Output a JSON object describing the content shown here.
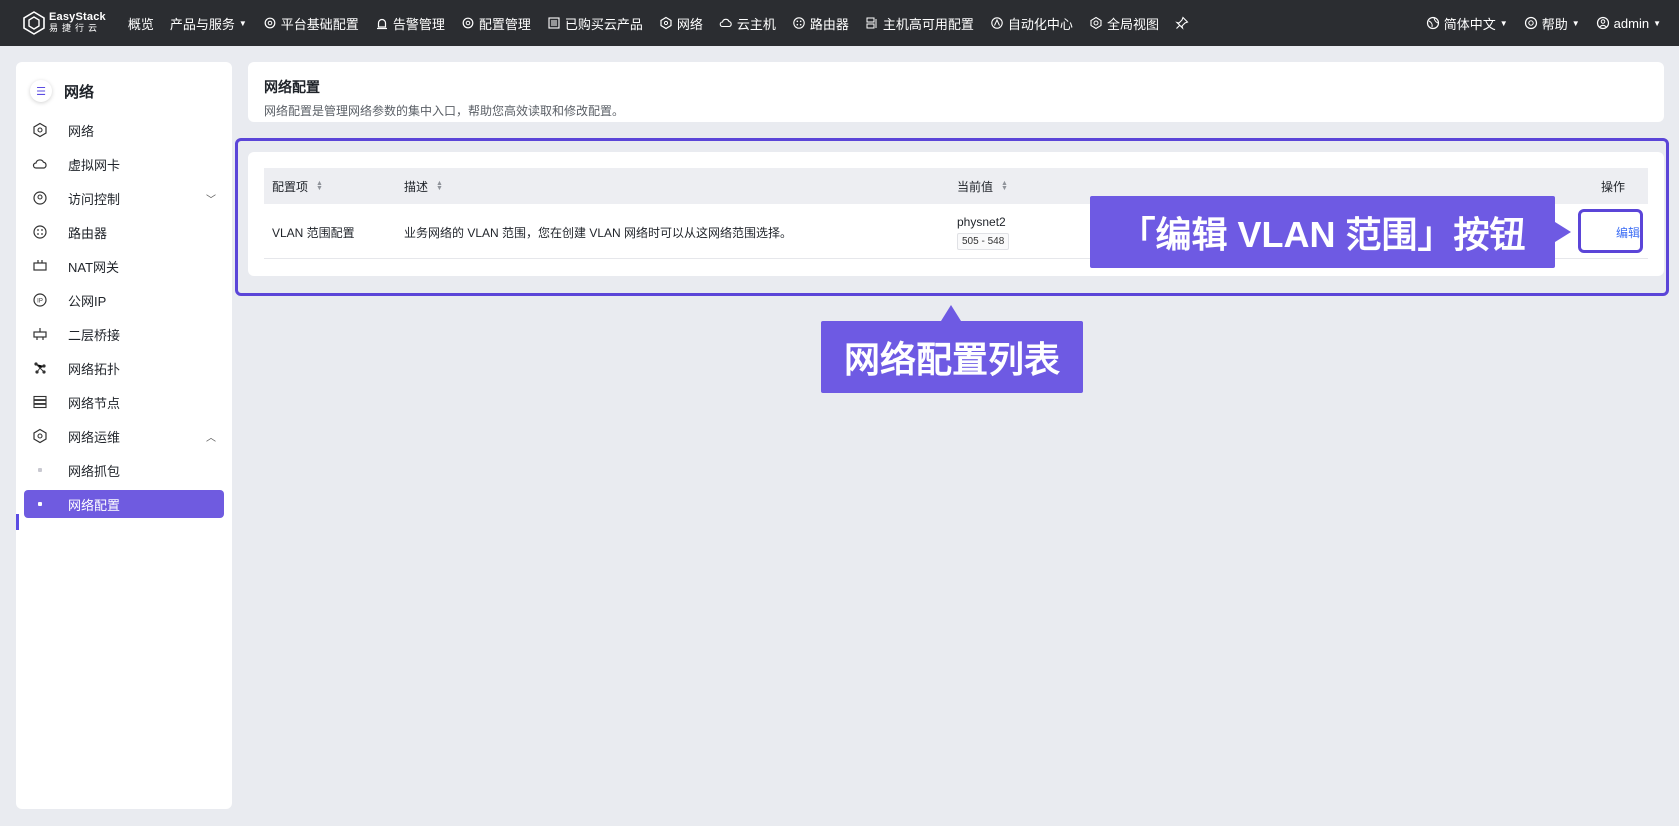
{
  "topbar": {
    "logo_en": "EasyStack",
    "logo_cn": "易捷行云",
    "nav": [
      {
        "label": "概览",
        "icon": "",
        "caret": false
      },
      {
        "label": "产品与服务",
        "icon": "",
        "caret": true
      },
      {
        "label": "平台基础配置",
        "icon": "gear-icon",
        "caret": false
      },
      {
        "label": "告警管理",
        "icon": "alarm-icon",
        "caret": false
      },
      {
        "label": "配置管理",
        "icon": "gear-icon",
        "caret": false
      },
      {
        "label": "已购买云产品",
        "icon": "list-icon",
        "caret": false
      },
      {
        "label": "网络",
        "icon": "network-icon",
        "caret": false
      },
      {
        "label": "云主机",
        "icon": "cloud-icon",
        "caret": false
      },
      {
        "label": "路由器",
        "icon": "router-icon",
        "caret": false
      },
      {
        "label": "主机高可用配置",
        "icon": "server-icon",
        "caret": false
      },
      {
        "label": "自动化中心",
        "icon": "automation-icon",
        "caret": false
      },
      {
        "label": "全局视图",
        "icon": "globe-icon",
        "caret": false
      }
    ],
    "language": "简体中文",
    "help": "帮助",
    "user": "admin"
  },
  "sidebar": {
    "title": "网络",
    "items": [
      {
        "label": "网络",
        "icon": "network-icon"
      },
      {
        "label": "虚拟网卡",
        "icon": "cloud-icon"
      },
      {
        "label": "访问控制",
        "icon": "access-control-icon"
      },
      {
        "label": "路由器",
        "icon": "router-icon"
      },
      {
        "label": "NAT网关",
        "icon": "nat-gateway-icon"
      },
      {
        "label": "公网IP",
        "icon": "ip-icon"
      },
      {
        "label": "二层桥接",
        "icon": "bridge-icon"
      },
      {
        "label": "网络拓扑",
        "icon": "topology-icon"
      },
      {
        "label": "网络节点",
        "icon": "node-icon"
      },
      {
        "label": "网络运维",
        "icon": "network-icon"
      },
      {
        "label": "网络抓包",
        "icon": "dot-icon"
      },
      {
        "label": "网络配置",
        "icon": "dot-icon"
      }
    ]
  },
  "page": {
    "title": "网络配置",
    "description": "网络配置是管理网络参数的集中入口，帮助您高效读取和修改配置。"
  },
  "table": {
    "columns": [
      "配置项",
      "描述",
      "当前值",
      "操作"
    ],
    "rows": [
      {
        "item": "VLAN 范围配置",
        "description": "业务网络的 VLAN 范围，您在创建 VLAN 网络时可以从这网络范围选择。",
        "value_name": "physnet2",
        "value_range": "505 - 548",
        "action": "编辑"
      }
    ]
  },
  "annotations": {
    "edit_callout": "「编辑 VLAN 范围」按钮",
    "list_callout": "网络配置列表"
  },
  "colors": {
    "accent": "#6e5ae3",
    "highlight_border": "#5b45d8",
    "link": "#3d6ef5",
    "topbar": "#2b2d31"
  }
}
